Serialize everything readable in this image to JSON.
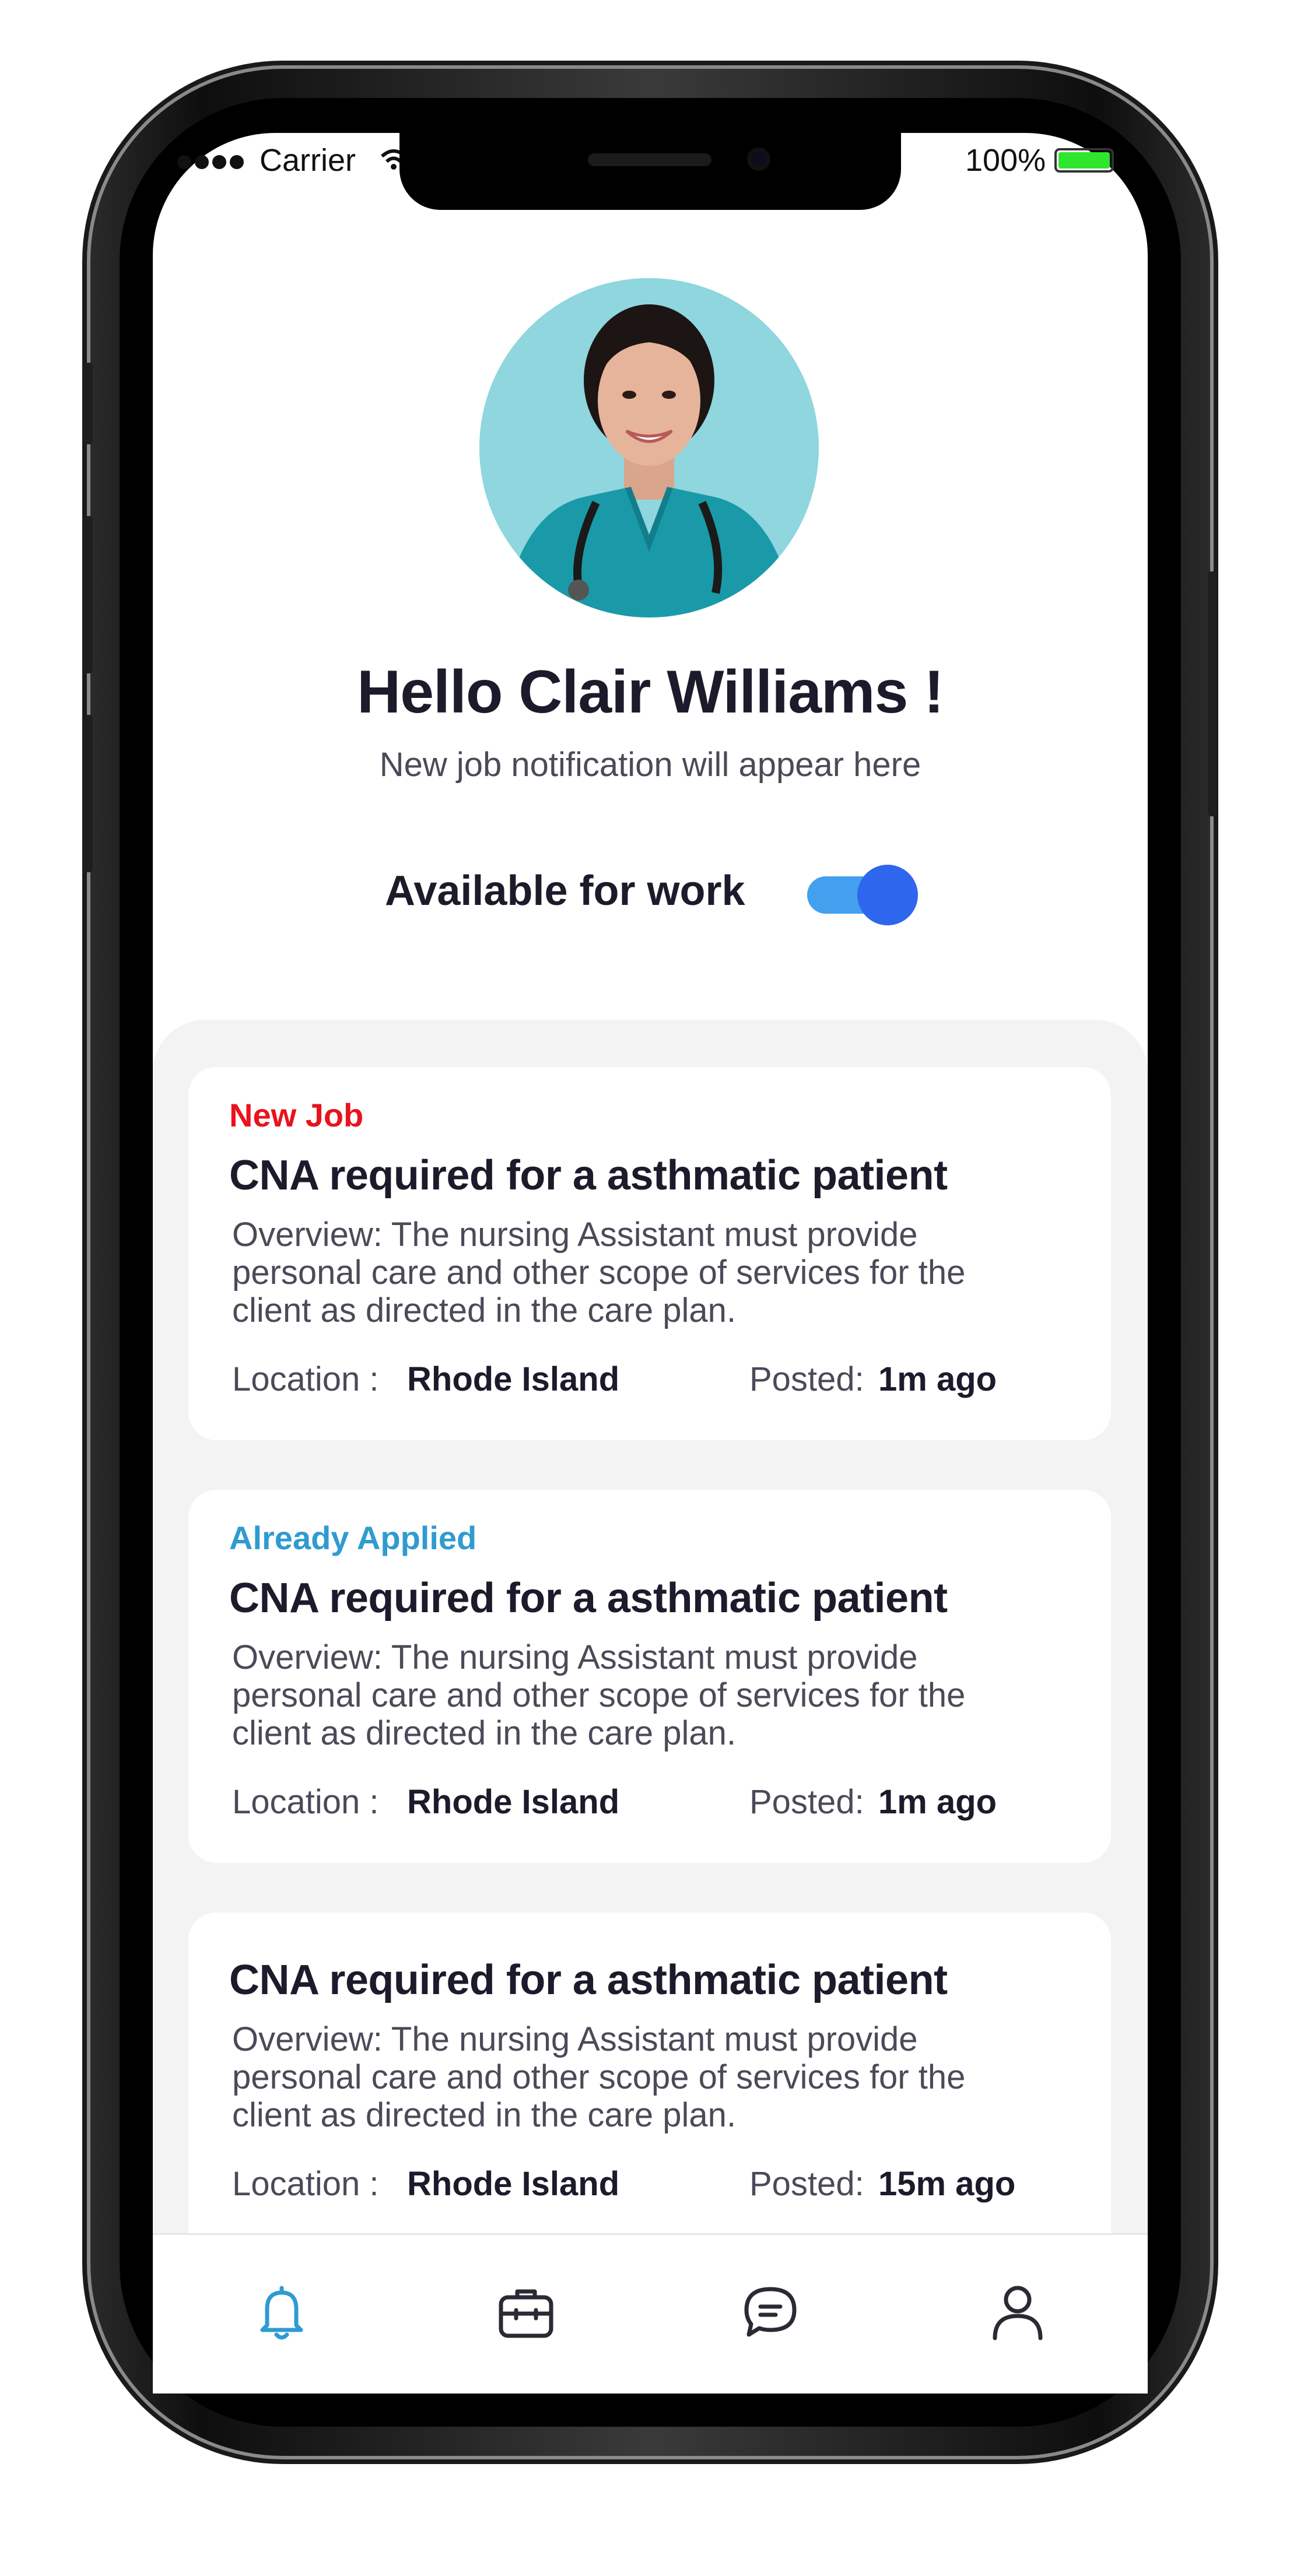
{
  "status_bar": {
    "carrier": "Carrier",
    "battery": "100%",
    "battery_color": "#2ee62e"
  },
  "profile": {
    "greeting": "Hello Clair Williams !",
    "subtitle": "New job notification will appear here",
    "available_label": "Available for work",
    "available": true
  },
  "colors": {
    "new_tag": "#e8131c",
    "applied_tag": "#2f9bd0",
    "toggle_track": "#43a0ee",
    "toggle_knob": "#2f66ee",
    "active_tab": "#2f9bd0"
  },
  "jobs": [
    {
      "tag": "New Job",
      "title": "CNA required for a asthmatic patient",
      "overview_line1": "Overview: The nursing Assistant must provide",
      "overview_line2": "personal care and other scope of services for the",
      "overview_line3": "client as directed in the care plan.",
      "location_label": "Location :",
      "location": "Rhode Island",
      "posted_label": "Posted:",
      "posted": "1m ago"
    },
    {
      "tag": "Already Applied",
      "title": "CNA required for a asthmatic patient",
      "overview_line1": "Overview: The nursing Assistant must provide",
      "overview_line2": "personal care and other scope of services for the",
      "overview_line3": "client as directed in the care plan.",
      "location_label": "Location :",
      "location": "Rhode Island",
      "posted_label": "Posted:",
      "posted": "1m ago"
    },
    {
      "tag": "",
      "title": "CNA required for a asthmatic patient",
      "overview_line1": "Overview: The nursing Assistant must provide",
      "overview_line2": "personal care and other scope of services for the",
      "overview_line3": "client as directed in the care plan.",
      "location_label": "Location :",
      "location": "Rhode Island",
      "posted_label": "Posted:",
      "posted": "15m ago"
    }
  ],
  "tabbar": {
    "tabs": [
      {
        "icon": "bell-icon",
        "active": true
      },
      {
        "icon": "briefcase-icon",
        "active": false
      },
      {
        "icon": "chat-icon",
        "active": false
      },
      {
        "icon": "user-icon",
        "active": false
      }
    ]
  }
}
